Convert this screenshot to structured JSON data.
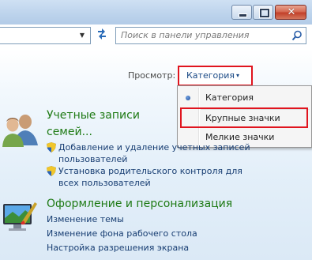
{
  "window": {
    "minimize_glyph": "",
    "maximize_glyph": "",
    "close_glyph": "✕"
  },
  "address": {
    "dropdown_glyph": "▼",
    "refresh_glyph": "⟲"
  },
  "search": {
    "placeholder": "Поиск в панели управления"
  },
  "view": {
    "label": "Просмотр:",
    "current": "Категория",
    "arrow": "▾"
  },
  "view_menu": {
    "items": [
      {
        "label": "Категория",
        "selected": true
      },
      {
        "label": "Крупные значки",
        "selected": false
      },
      {
        "label": "Мелкие значки",
        "selected": false
      }
    ]
  },
  "categories": [
    {
      "title_line1": "Учетные записи",
      "title_line2": "семей...",
      "icon": "users-icon",
      "links": [
        {
          "text_line1": "Добавление и удаление учетных записей",
          "text_line2": "пользователей",
          "icon": "shield-icon"
        },
        {
          "text_line1": "Установка родительского контроля для",
          "text_line2": "всех пользователей",
          "icon": "shield-icon"
        }
      ]
    },
    {
      "title": "Оформление и персонализация",
      "icon": "appearance-icon",
      "links": [
        {
          "text": "Изменение темы"
        },
        {
          "text": "Изменение фона рабочего стола"
        },
        {
          "text": "Настройка разрешения экрана"
        }
      ]
    }
  ],
  "colors": {
    "accent_highlight": "#e0141e",
    "category_title": "#1e7a14",
    "link": "#173d72"
  }
}
